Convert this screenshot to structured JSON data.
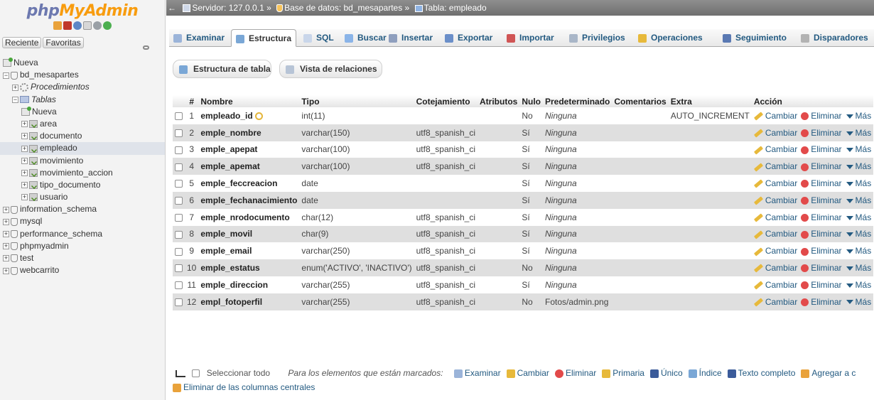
{
  "logo": {
    "php": "php",
    "myadmin": "MyAdmin"
  },
  "navigation": {
    "recent_label": "Reciente",
    "favorites_label": "Favoritas",
    "tree": [
      {
        "label": "Nueva",
        "level": 0,
        "kind": "new"
      },
      {
        "label": "bd_mesapartes",
        "level": 0,
        "kind": "db",
        "expanded": true
      },
      {
        "label": "Procedimientos",
        "level": 1,
        "kind": "proc",
        "italic": true
      },
      {
        "label": "Tablas",
        "level": 1,
        "kind": "folder",
        "italic": true,
        "expanded": true
      },
      {
        "label": "Nueva",
        "level": 2,
        "kind": "new"
      },
      {
        "label": "area",
        "level": 2,
        "kind": "table"
      },
      {
        "label": "documento",
        "level": 2,
        "kind": "table"
      },
      {
        "label": "empleado",
        "level": 2,
        "kind": "table",
        "selected": true
      },
      {
        "label": "movimiento",
        "level": 2,
        "kind": "table"
      },
      {
        "label": "movimiento_accion",
        "level": 2,
        "kind": "table"
      },
      {
        "label": "tipo_documento",
        "level": 2,
        "kind": "table"
      },
      {
        "label": "usuario",
        "level": 2,
        "kind": "table"
      },
      {
        "label": "information_schema",
        "level": 0,
        "kind": "db"
      },
      {
        "label": "mysql",
        "level": 0,
        "kind": "db"
      },
      {
        "label": "performance_schema",
        "level": 0,
        "kind": "db"
      },
      {
        "label": "phpmyadmin",
        "level": 0,
        "kind": "db"
      },
      {
        "label": "test",
        "level": 0,
        "kind": "db"
      },
      {
        "label": "webcarrito",
        "level": 0,
        "kind": "db"
      }
    ]
  },
  "breadcrumb": {
    "server": "Servidor: 127.0.0.1 »",
    "database": "Base de datos: bd_mesapartes »",
    "table": "Tabla: empleado"
  },
  "tabs": [
    {
      "label": "Examinar",
      "icon": "table-icon"
    },
    {
      "label": "Estructura",
      "icon": "structure-icon",
      "active": true
    },
    {
      "label": "SQL",
      "icon": "sql-icon"
    },
    {
      "label": "Buscar",
      "icon": "search-icon"
    },
    {
      "label": "Insertar",
      "icon": "insert-icon"
    },
    {
      "label": "Exportar",
      "icon": "export-icon"
    },
    {
      "label": "Importar",
      "icon": "import-icon"
    },
    {
      "label": "Privilegios",
      "icon": "privileges-icon"
    },
    {
      "label": "Operaciones",
      "icon": "operations-icon"
    },
    {
      "label": "Seguimiento",
      "icon": "tracking-icon"
    },
    {
      "label": "Disparadores",
      "icon": "triggers-icon"
    }
  ],
  "subnav": {
    "table_structure": "Estructura de tabla",
    "relation_view": "Vista de relaciones"
  },
  "columns_header": [
    "#",
    "Nombre",
    "Tipo",
    "Cotejamiento",
    "Atributos",
    "Nulo",
    "Predeterminado",
    "Comentarios",
    "Extra",
    "Acción"
  ],
  "rows": [
    {
      "num": "1",
      "name": "empleado_id",
      "primary": true,
      "type": "int(11)",
      "collation": "",
      "attributes": "",
      "null": "No",
      "default": "Ninguna",
      "default_italic": true,
      "comments": "",
      "extra": "AUTO_INCREMENT"
    },
    {
      "num": "2",
      "name": "emple_nombre",
      "type": "varchar(150)",
      "collation": "utf8_spanish_ci",
      "attributes": "",
      "null": "Sí",
      "default": "Ninguna",
      "default_italic": true,
      "comments": "",
      "extra": ""
    },
    {
      "num": "3",
      "name": "emple_apepat",
      "type": "varchar(100)",
      "collation": "utf8_spanish_ci",
      "attributes": "",
      "null": "Sí",
      "default": "Ninguna",
      "default_italic": true,
      "comments": "",
      "extra": ""
    },
    {
      "num": "4",
      "name": "emple_apemat",
      "type": "varchar(100)",
      "collation": "utf8_spanish_ci",
      "attributes": "",
      "null": "Sí",
      "default": "Ninguna",
      "default_italic": true,
      "comments": "",
      "extra": ""
    },
    {
      "num": "5",
      "name": "emple_feccreacion",
      "type": "date",
      "collation": "",
      "attributes": "",
      "null": "Sí",
      "default": "Ninguna",
      "default_italic": true,
      "comments": "",
      "extra": ""
    },
    {
      "num": "6",
      "name": "emple_fechanacimiento",
      "type": "date",
      "collation": "",
      "attributes": "",
      "null": "Sí",
      "default": "Ninguna",
      "default_italic": true,
      "comments": "",
      "extra": ""
    },
    {
      "num": "7",
      "name": "emple_nrodocumento",
      "type": "char(12)",
      "collation": "utf8_spanish_ci",
      "attributes": "",
      "null": "Sí",
      "default": "Ninguna",
      "default_italic": true,
      "comments": "",
      "extra": ""
    },
    {
      "num": "8",
      "name": "emple_movil",
      "type": "char(9)",
      "collation": "utf8_spanish_ci",
      "attributes": "",
      "null": "Sí",
      "default": "Ninguna",
      "default_italic": true,
      "comments": "",
      "extra": ""
    },
    {
      "num": "9",
      "name": "emple_email",
      "type": "varchar(250)",
      "collation": "utf8_spanish_ci",
      "attributes": "",
      "null": "Sí",
      "default": "Ninguna",
      "default_italic": true,
      "comments": "",
      "extra": ""
    },
    {
      "num": "10",
      "name": "emple_estatus",
      "type": "enum('ACTIVO', 'INACTIVO')",
      "collation": "utf8_spanish_ci",
      "attributes": "",
      "null": "No",
      "default": "Ninguna",
      "default_italic": true,
      "comments": "",
      "extra": ""
    },
    {
      "num": "11",
      "name": "emple_direccion",
      "type": "varchar(255)",
      "collation": "utf8_spanish_ci",
      "attributes": "",
      "null": "Sí",
      "default": "Ninguna",
      "default_italic": true,
      "comments": "",
      "extra": ""
    },
    {
      "num": "12",
      "name": "empl_fotoperfil",
      "type": "varchar(255)",
      "collation": "utf8_spanish_ci",
      "attributes": "",
      "null": "No",
      "default": "Fotos/admin.png",
      "default_italic": false,
      "comments": "",
      "extra": ""
    }
  ],
  "row_actions": {
    "change": "Cambiar",
    "drop": "Eliminar",
    "more": "Más"
  },
  "footer": {
    "select_all": "Seleccionar todo",
    "with_selected": "Para los elementos que están marcados:",
    "actions": [
      "Examinar",
      "Cambiar",
      "Eliminar",
      "Primaria",
      "Único",
      "Índice",
      "Texto completo",
      "Agregar a c"
    ],
    "central_remove": "Eliminar de las columnas centrales"
  },
  "colors": {
    "link": "#235a81",
    "logo_php": "#6c78af",
    "logo_myadmin": "#f89c0e",
    "topbar": "#7f7f7f",
    "row_alt": "#dfdfdf"
  }
}
